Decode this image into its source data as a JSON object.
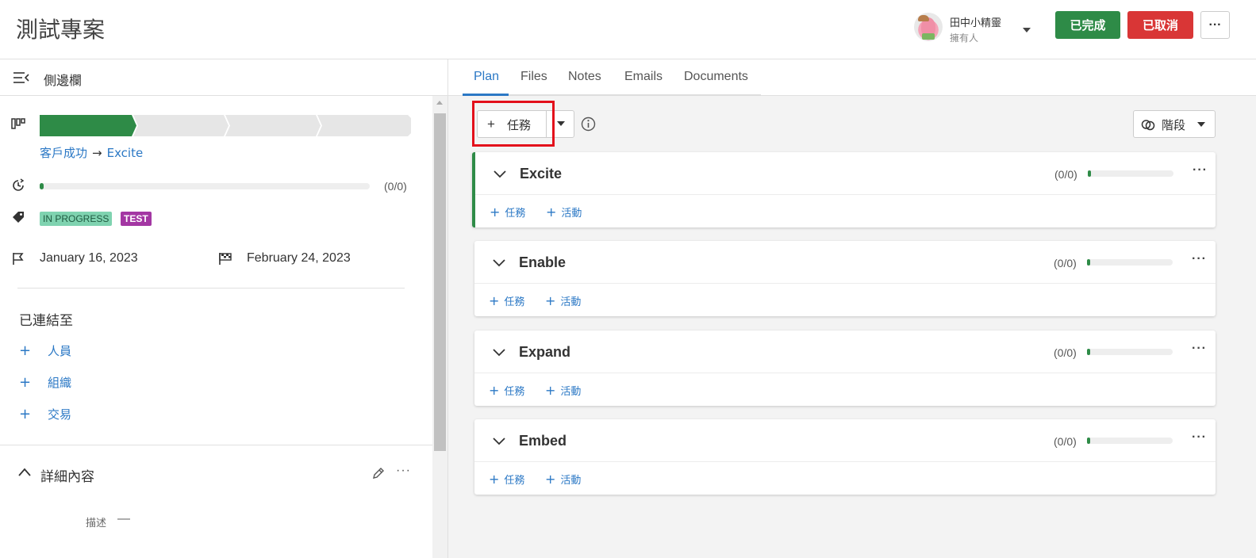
{
  "header": {
    "title": "測試專案",
    "owner_name": "田中小精靈",
    "owner_role": "擁有人",
    "done_label": "已完成",
    "cancel_label": "已取消",
    "more_label": "···"
  },
  "sidebar": {
    "title": "側邊欄",
    "stages": {
      "count": 4,
      "active": 1
    },
    "breadcrumb": {
      "parent": "客戶成功",
      "arrow": "→",
      "current": "Excite"
    },
    "progress": {
      "value": 0.0,
      "count": "(0/0)"
    },
    "tags": [
      "IN PROGRESS",
      "TEST"
    ],
    "start_date": "January 16, 2023",
    "end_date": "February 24, 2023",
    "linked_title": "已連結至",
    "linked_items": [
      {
        "plus": "+",
        "label": "人員"
      },
      {
        "plus": "+",
        "label": "組織"
      },
      {
        "plus": "+",
        "label": "交易"
      }
    ],
    "details_title": "詳細內容",
    "details_more": "···",
    "description_label": "描述",
    "description_value": "—"
  },
  "main": {
    "tabs": [
      "Plan",
      "Files",
      "Notes",
      "Emails",
      "Documents"
    ],
    "active_tab": "Plan",
    "add_task": {
      "plus": "+",
      "label": "任務"
    },
    "stage_select_label": "階段",
    "phases": [
      {
        "name": "Excite",
        "count": "(0/0)",
        "progress": 0.0,
        "current": true,
        "task_label": "任務",
        "activity_label": "活動",
        "more": "···"
      },
      {
        "name": "Enable",
        "count": "(0/0)",
        "progress": 0.0,
        "current": false,
        "task_label": "任務",
        "activity_label": "活動",
        "more": "···"
      },
      {
        "name": "Expand",
        "count": "(0/0)",
        "progress": 0.0,
        "current": false,
        "task_label": "任務",
        "activity_label": "活動",
        "more": "···"
      },
      {
        "name": "Embed",
        "count": "(0/0)",
        "progress": 0.0,
        "current": false,
        "task_label": "任務",
        "activity_label": "活動",
        "more": "···"
      }
    ]
  },
  "colors": {
    "brand_green": "#2e8b47",
    "danger_red": "#d93636",
    "link_blue": "#2b78c5",
    "tag_progress": "#7fd3b0",
    "tag_test": "#a337a3",
    "highlight": "#e3101b"
  }
}
